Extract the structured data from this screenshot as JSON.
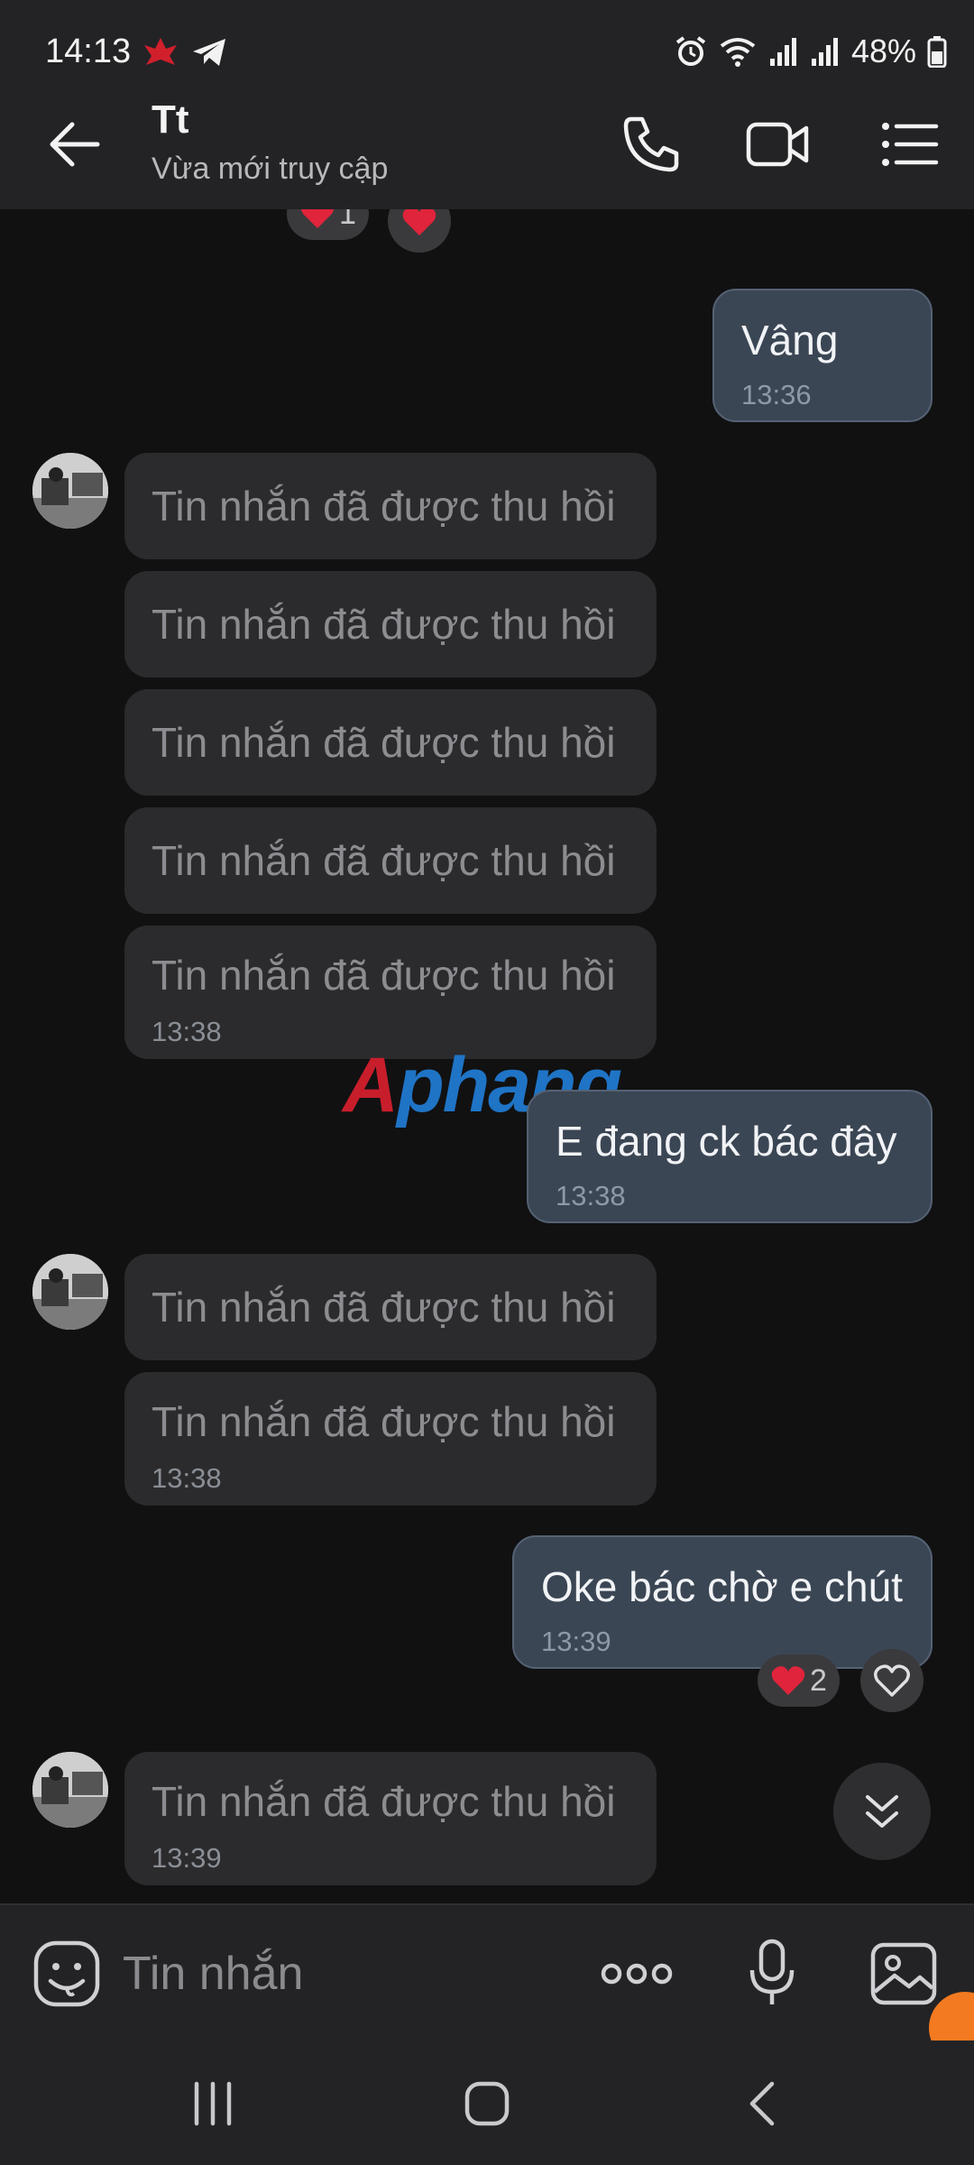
{
  "status_bar": {
    "time": "14:13",
    "battery": "48%"
  },
  "header": {
    "name": "Tt",
    "status": "Vừa mới truy cập"
  },
  "messages": {
    "top_reaction_count": "1",
    "m1": {
      "text": "Vâng",
      "time": "13:36"
    },
    "recalled_text": "Tin nhắn đã được thu hồi",
    "group1_time": "13:38",
    "m2": {
      "text": "E đang ck bác đây",
      "time": "13:38"
    },
    "group2_time": "13:38",
    "m3": {
      "text": "Oke bác chờ e chút",
      "time": "13:39",
      "reaction_count": "2"
    },
    "group3_time": "13:39"
  },
  "watermark": "Aphang",
  "input": {
    "placeholder": "Tin nhắn"
  },
  "colors": {
    "background": "#111112",
    "bar": "#232325",
    "incoming": "#2b2b2d",
    "outgoing": "#3b4654",
    "heart": "#e0243b",
    "accent_orange": "#f37a20"
  },
  "icons": [
    "back-arrow-icon",
    "phone-icon",
    "video-icon",
    "menu-icon",
    "heart-icon",
    "chevron-double-down-icon",
    "sticker-icon",
    "more-dots-icon",
    "mic-icon",
    "image-icon",
    "recent-apps-icon",
    "home-icon",
    "nav-back-icon"
  ]
}
